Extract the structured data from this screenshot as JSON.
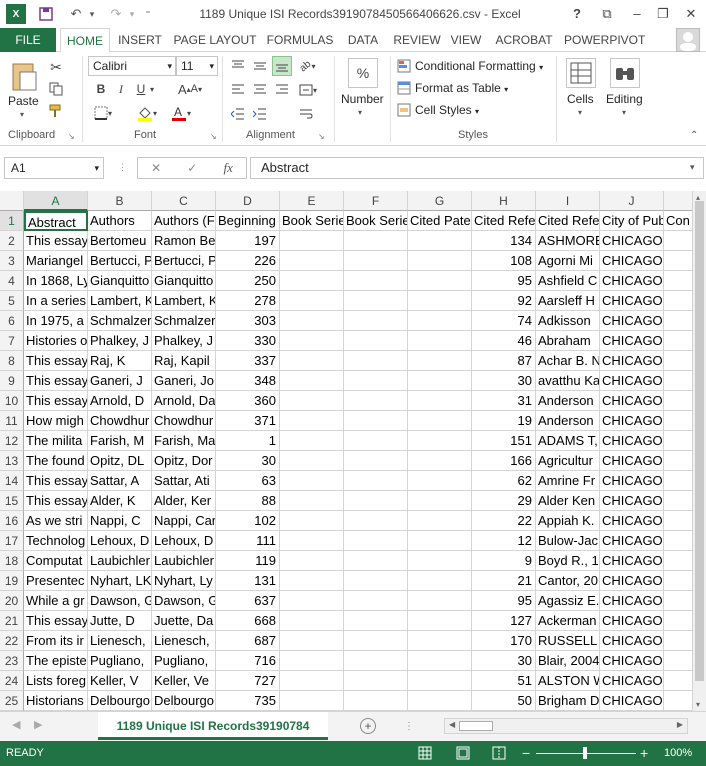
{
  "window": {
    "title": "1189 Unique ISI Records3919078450566406626.csv - Excel"
  },
  "tabs": [
    "FILE",
    "HOME",
    "INSERT",
    "PAGE LAYOUT",
    "FORMULAS",
    "DATA",
    "REVIEW",
    "VIEW",
    "ACROBAT",
    "POWERPIVOT"
  ],
  "ribbon": {
    "paste": "Paste",
    "font_name": "Calibri",
    "font_size": "11",
    "number": "Number",
    "conditional_formatting": "Conditional Formatting",
    "format_as_table": "Format as Table",
    "cell_styles": "Cell Styles",
    "cells": "Cells",
    "editing": "Editing",
    "groups": {
      "clipboard": "Clipboard",
      "font": "Font",
      "alignment": "Alignment",
      "styles": "Styles"
    }
  },
  "formula_bar": {
    "name_box": "A1",
    "fx": "fx",
    "value": "Abstract"
  },
  "columns": [
    "A",
    "B",
    "C",
    "D",
    "E",
    "F",
    "G",
    "H",
    "I",
    "J"
  ],
  "headers": [
    "Abstract",
    "Authors",
    "Authors (Full)",
    "Beginning Page",
    "Book Series Title",
    "Book Series Subtitle",
    "Cited Patent",
    "Cited Reference Count",
    "Cited References",
    "City of Publisher",
    "Con"
  ],
  "rows": [
    {
      "n": "2",
      "a": "This essay",
      "b": "Bertomeu",
      "c": "Ramon Be",
      "d": "197",
      "h": "134",
      "i": "ASHMORE",
      "j": "CHICAGO"
    },
    {
      "n": "3",
      "a": "Mariangel",
      "b": "Bertucci, P",
      "c": "Bertucci, P",
      "d": "226",
      "h": "108",
      "i": "Agorni Mi",
      "j": "CHICAGO"
    },
    {
      "n": "4",
      "a": "In 1868, Ly",
      "b": "Gianquitto",
      "c": "Gianquitto",
      "d": "250",
      "h": "95",
      "i": "Ashfield C",
      "j": "CHICAGO"
    },
    {
      "n": "5",
      "a": "In a series",
      "b": "Lambert, K",
      "c": "Lambert, K",
      "d": "278",
      "h": "92",
      "i": "Aarsleff H",
      "j": "CHICAGO"
    },
    {
      "n": "6",
      "a": "In 1975, a",
      "b": "Schmalzer",
      "c": "Schmalzer",
      "d": "303",
      "h": "74",
      "i": "Adkisson",
      "j": "CHICAGO"
    },
    {
      "n": "7",
      "a": "Histories o",
      "b": "Phalkey, J",
      "c": "Phalkey, J",
      "d": "330",
      "h": "46",
      "i": "Abraham",
      "j": "CHICAGO"
    },
    {
      "n": "8",
      "a": "This essay",
      "b": "Raj, K",
      "c": "Raj, Kapil",
      "d": "337",
      "h": "87",
      "i": "Achar B. N",
      "j": "CHICAGO"
    },
    {
      "n": "9",
      "a": "This essay",
      "b": "Ganeri, J",
      "c": "Ganeri, Jo",
      "d": "348",
      "h": "30",
      "i": "avatthu Ka",
      "j": "CHICAGO"
    },
    {
      "n": "10",
      "a": "This essay",
      "b": "Arnold, D",
      "c": "Arnold, Da",
      "d": "360",
      "h": "31",
      "i": "Anderson",
      "j": "CHICAGO"
    },
    {
      "n": "11",
      "a": "How migh",
      "b": "Chowdhur",
      "c": "Chowdhur",
      "d": "371",
      "h": "19",
      "i": "Anderson",
      "j": "CHICAGO"
    },
    {
      "n": "12",
      "a": "The milita",
      "b": "Farish, M",
      "c": "Farish, Ma",
      "d": "1",
      "h": "151",
      "i": "ADAMS T,",
      "j": "CHICAGO"
    },
    {
      "n": "13",
      "a": "The found",
      "b": "Opitz, DL",
      "c": "Opitz, Dor",
      "d": "30",
      "h": "166",
      "i": "Agricultur",
      "j": "CHICAGO"
    },
    {
      "n": "14",
      "a": "This essay",
      "b": "Sattar, A",
      "c": "Sattar, Ati",
      "d": "63",
      "h": "62",
      "i": "Amrine Fr",
      "j": "CHICAGO"
    },
    {
      "n": "15",
      "a": "This essay",
      "b": "Alder, K",
      "c": "Alder, Ker",
      "d": "88",
      "h": "29",
      "i": "Alder Ken",
      "j": "CHICAGO"
    },
    {
      "n": "16",
      "a": "As we stri",
      "b": "Nappi, C",
      "c": "Nappi, Car",
      "d": "102",
      "h": "22",
      "i": "Appiah K.",
      "j": "CHICAGO"
    },
    {
      "n": "17",
      "a": "Technolog",
      "b": "Lehoux, D",
      "c": "Lehoux, D",
      "d": "111",
      "h": "12",
      "i": "Bulow-Jac",
      "j": "CHICAGO"
    },
    {
      "n": "18",
      "a": "Computat",
      "b": "Laubichler",
      "c": "Laubichler",
      "d": "119",
      "h": "9",
      "i": "Boyd R., 1",
      "j": "CHICAGO"
    },
    {
      "n": "19",
      "a": "Presentec",
      "b": "Nyhart, LK",
      "c": "Nyhart, Ly",
      "d": "131",
      "h": "21",
      "i": "Cantor, 20",
      "j": "CHICAGO"
    },
    {
      "n": "20",
      "a": "While a gr",
      "b": "Dawson, G",
      "c": "Dawson, G",
      "d": "637",
      "h": "95",
      "i": "Agassiz E.",
      "j": "CHICAGO"
    },
    {
      "n": "21",
      "a": "This essay",
      "b": "Jutte, D",
      "c": "Juette, Da",
      "d": "668",
      "h": "127",
      "i": "Ackerman",
      "j": "CHICAGO"
    },
    {
      "n": "22",
      "a": "From its ir",
      "b": "Lienesch,",
      "c": "Lienesch,",
      "d": "687",
      "h": "170",
      "i": "RUSSELL C",
      "j": "CHICAGO"
    },
    {
      "n": "23",
      "a": "The episte",
      "b": "Pugliano,",
      "c": "Pugliano,",
      "d": "716",
      "h": "30",
      "i": "Blair, 2004",
      "j": "CHICAGO"
    },
    {
      "n": "24",
      "a": "Lists foreg",
      "b": "Keller, V",
      "c": "Keller, Ve",
      "d": "727",
      "h": "51",
      "i": "ALSTON W",
      "j": "CHICAGO"
    },
    {
      "n": "25",
      "a": "Historians",
      "b": "Delbourgo",
      "c": "Delbourgo",
      "d": "735",
      "h": "50",
      "i": "Brigham D",
      "j": "CHICAGO"
    }
  ],
  "sheet_tab": "1189 Unique ISI Records39190784",
  "status": {
    "ready": "READY",
    "zoom": "100%"
  }
}
